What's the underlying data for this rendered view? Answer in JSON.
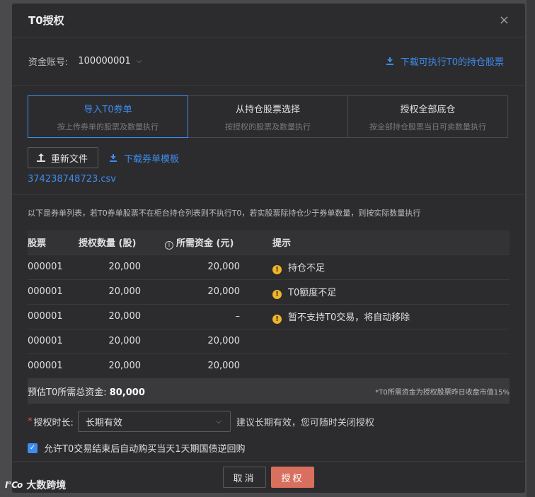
{
  "dialog": {
    "title": "T0授权",
    "close_glyph": "×"
  },
  "account": {
    "label": "资金账号:",
    "value": "100000001",
    "download_link": "下载可执行T0的持仓股票"
  },
  "modes": [
    {
      "title": "导入T0券单",
      "subtitle": "按上传券单的股票及数量执行",
      "active": true
    },
    {
      "title": "从持仓股票选择",
      "subtitle": "按授权的股票及数量执行",
      "active": false
    },
    {
      "title": "授权全部底仓",
      "subtitle": "按全部持仓股票当日可卖数量执行",
      "active": false
    }
  ],
  "file": {
    "reupload_label": "重新文件",
    "template_link": "下载券单模板",
    "filename": "374238748723.csv"
  },
  "notice": "以下是券单列表，若T0券单股票不在柜台持仓列表则不执行T0，若实股票际持仓少于券单数量，则按实际数量执行",
  "table": {
    "headers": {
      "stock": "股票",
      "qty": "授权数量 (股)",
      "funds": "所需资金 (元)",
      "tip": "提示"
    },
    "rows": [
      {
        "stock": "000001",
        "qty": "20,000",
        "funds": "20,000",
        "tip": "持仓不足",
        "warn": true
      },
      {
        "stock": "000001",
        "qty": "20,000",
        "funds": "20,000",
        "tip": "T0额度不足",
        "warn": true
      },
      {
        "stock": "000001",
        "qty": "20,000",
        "funds": "–",
        "tip": "暂不支持T0交易，将自动移除",
        "warn": true
      },
      {
        "stock": "000001",
        "qty": "20,000",
        "funds": "20,000",
        "tip": "",
        "warn": false
      },
      {
        "stock": "000001",
        "qty": "20,000",
        "funds": "20,000",
        "tip": "",
        "warn": false
      }
    ]
  },
  "summary": {
    "label": "预估T0所需总资金:",
    "value": "80,000",
    "note": "*T0所需资金为授权股票昨日收盘市值15%"
  },
  "duration": {
    "required_mark": "*",
    "label": "授权时长:",
    "selected": "长期有效",
    "hint": "建议长期有效，您可随时关闭授权"
  },
  "auto_repo": {
    "checked": true,
    "label": "允许T0交易结束后自动购买当天1天期国债逆回购"
  },
  "footer": {
    "cancel_label": "取消",
    "confirm_label": "授权"
  },
  "watermark": {
    "logo": "I℃o",
    "text": "大数跨境"
  },
  "colors": {
    "accent": "#3d8cf0",
    "confirm": "#d9705f",
    "warning": "#f0b429",
    "background": "#2c2c2e"
  }
}
